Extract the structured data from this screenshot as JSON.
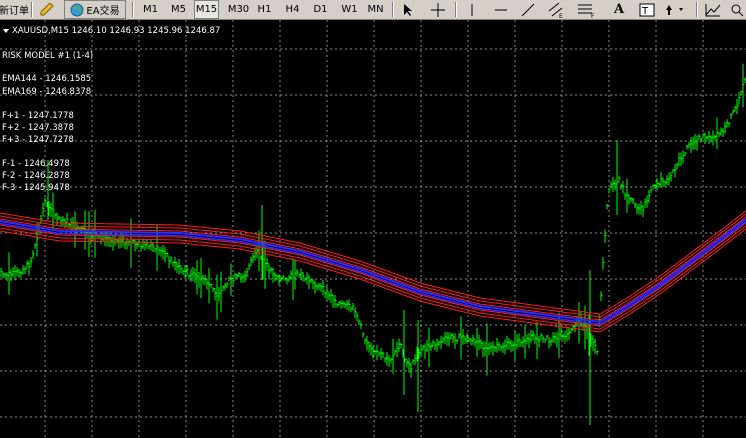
{
  "toolbar": {
    "new_order_label": "新订单",
    "ea_label": "EA交易",
    "timeframes": [
      "M1",
      "M5",
      "M15",
      "M30",
      "H1",
      "H4",
      "D1",
      "W1",
      "MN"
    ],
    "active_timeframe": "M15"
  },
  "chart": {
    "symbol_line": "XAUUSD,M15  1246.10 1246.93 1245.96 1246.87",
    "indicator_title": "RISK MODEL #1 (1-4)",
    "ema_lines": [
      "EMA144 - 1246.1585",
      "EMA169 - 1246.8378"
    ],
    "f_plus": [
      "F+1 - 1247.1778",
      "F+2 - 1247.3878",
      "F+3 - 1247.7278"
    ],
    "f_minus": [
      "F-1 - 1246.4978",
      "F-2 - 1246.2878",
      "F-3 - 1245.9478"
    ],
    "colors": {
      "background": "#000000",
      "bars": "#00ff00",
      "grid": "#c0c0c0",
      "ema_blue": "#2b2bff",
      "band_red": "#ff1a1a"
    }
  }
}
